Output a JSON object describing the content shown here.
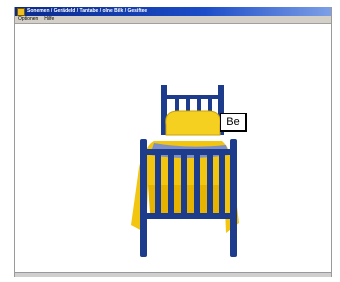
{
  "window": {
    "title": "Sonemen / Gerädeld / Tantabe / olne Bilk / Gesiftee"
  },
  "menu": {
    "items": [
      {
        "label": "Optionen"
      },
      {
        "label": "Hilfe"
      }
    ]
  },
  "scene": {
    "object_icon": "bed-icon",
    "label": "Be"
  },
  "colors": {
    "frame": "#1d3d8c",
    "blanket": "#f2c510",
    "pillow": "#f5d020",
    "stripe": "#7d8fc4"
  }
}
